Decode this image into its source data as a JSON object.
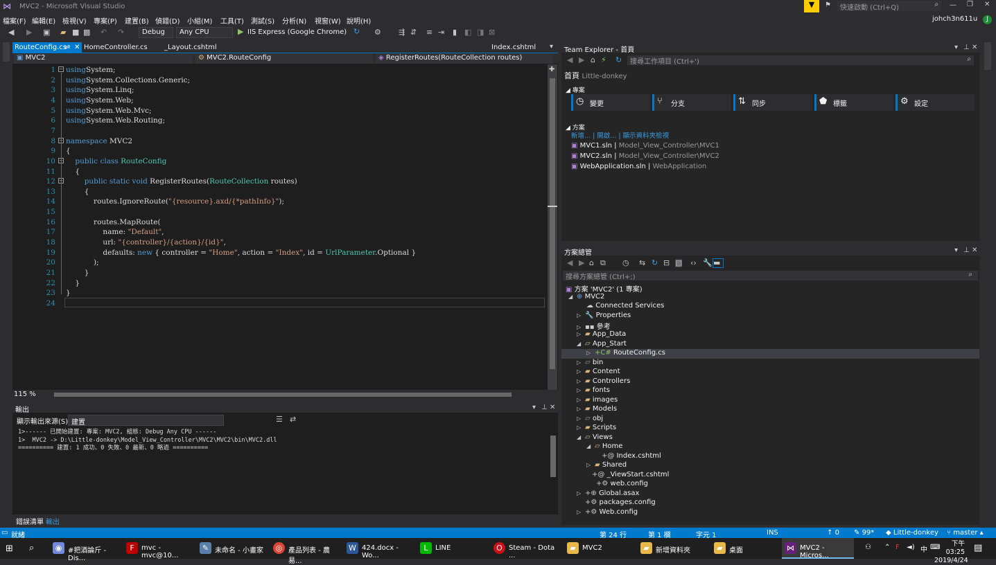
{
  "window": {
    "title": "MVC2 - Microsoft Visual Studio",
    "quick_launch": "快速啟動 (Ctrl+Q)",
    "user": "johch3n611u",
    "user_initial": "J"
  },
  "menu": [
    "檔案(F)",
    "編輯(E)",
    "檢視(V)",
    "專案(P)",
    "建置(B)",
    "偵錯(D)",
    "小組(M)",
    "工具(T)",
    "測試(S)",
    "分析(N)",
    "視窗(W)",
    "說明(H)"
  ],
  "toolbar": {
    "config": "Debug",
    "platform": "Any CPU",
    "run_label": "IIS Express (Google Chrome)"
  },
  "editor": {
    "tabs": [
      "RouteConfig.cs",
      "HomeController.cs",
      "_Layout.cshtml",
      "Index.cshtml"
    ],
    "nav": [
      "MVC2",
      "MVC2.RouteConfig",
      "RegisterRoutes(RouteCollection routes)"
    ],
    "zoom": "115 %",
    "lines": [
      [
        [
          "kw",
          "using"
        ],
        [
          "",
          "System;"
        ]
      ],
      [
        [
          "kw",
          "using"
        ],
        [
          "",
          "System.Collections.Generic;"
        ]
      ],
      [
        [
          "kw",
          "using"
        ],
        [
          "",
          "System.Linq;"
        ]
      ],
      [
        [
          "kw",
          "using"
        ],
        [
          "",
          "System.Web;"
        ]
      ],
      [
        [
          "kw",
          "using"
        ],
        [
          "",
          "System.Web.Mvc;"
        ]
      ],
      [
        [
          "kw",
          "using"
        ],
        [
          "",
          "System.Web.Routing;"
        ]
      ],
      [],
      [
        [
          "kw",
          "namespace"
        ],
        [
          "",
          " MVC2"
        ]
      ],
      [
        [
          "",
          "{"
        ]
      ],
      [
        [
          "",
          "    "
        ],
        [
          "kw",
          "public class"
        ],
        [
          "ty",
          " RouteConfig"
        ]
      ],
      [
        [
          "",
          "    {"
        ]
      ],
      [
        [
          "",
          "        "
        ],
        [
          "kw",
          "public static void"
        ],
        [
          "",
          " RegisterRoutes("
        ],
        [
          "ty",
          "RouteCollection"
        ],
        [
          "",
          " routes)"
        ]
      ],
      [
        [
          "",
          "        {"
        ]
      ],
      [
        [
          "",
          "            routes.IgnoreRoute("
        ],
        [
          "st",
          "\"{resource}.axd/{*pathInfo}\""
        ],
        [
          "",
          ");"
        ]
      ],
      [],
      [
        [
          "",
          "            routes.MapRoute("
        ]
      ],
      [
        [
          "",
          "                name: "
        ],
        [
          "st",
          "\"Default\""
        ],
        [
          "",
          ","
        ]
      ],
      [
        [
          "",
          "                url: "
        ],
        [
          "st",
          "\"{controller}/{action}/{id}\""
        ],
        [
          "",
          ","
        ]
      ],
      [
        [
          "",
          "                defaults: "
        ],
        [
          "kw",
          "new"
        ],
        [
          "",
          " { controller = "
        ],
        [
          "st",
          "\"Home\""
        ],
        [
          "",
          ", action = "
        ],
        [
          "st",
          "\"Index\""
        ],
        [
          "",
          ", id = "
        ],
        [
          "ty",
          "UrlParameter"
        ],
        [
          "",
          ".Optional }"
        ]
      ],
      [
        [
          "",
          "            );"
        ]
      ],
      [
        [
          "",
          "        }"
        ]
      ],
      [
        [
          "",
          "    }"
        ]
      ],
      [
        [
          "",
          "}"
        ]
      ],
      []
    ]
  },
  "output": {
    "title": "輸出",
    "source_label": "顯示輸出來源(S):",
    "source_value": "建置",
    "lines": [
      "1>------ 已開始建置: 專案: MVC2, 組態: Debug Any CPU ------",
      "1>  MVC2 -> D:\\Little-donkey\\Model_View_Controller\\MVC2\\MVC2\\bin\\MVC2.dll",
      "========== 建置: 1 成功、0 失敗、0 最新、0 略過 =========="
    ]
  },
  "bottom_tabs": [
    "錯誤清單",
    "輸出"
  ],
  "team_explorer": {
    "title": "Team Explorer - 首頁",
    "search": "搜尋工作項目 (Ctrl+')",
    "home": "首頁",
    "repo": "Little-donkey",
    "project_header": "專案",
    "tiles": [
      "變更",
      "分支",
      "同步",
      "標籤",
      "設定"
    ],
    "solution_header": "方案",
    "links": [
      "新增...",
      "開啟...",
      "顯示資料夾檢視"
    ],
    "solutions": [
      {
        "name": "MVC1.sln",
        "path": "Model_View_Controller\\MVC1"
      },
      {
        "name": "MVC2.sln",
        "path": "Model_View_Controller\\MVC2"
      },
      {
        "name": "WebApplication.sln",
        "path": "WebApplication"
      }
    ]
  },
  "solution_explorer": {
    "title": "方案總管",
    "search": "搜尋方案總管 (Ctrl+;)",
    "items": [
      "方案 'MVC2' (1 專案)",
      "MVC2",
      "Connected Services",
      "Properties",
      "參考",
      "App_Data",
      "App_Start",
      "RouteConfig.cs",
      "bin",
      "Content",
      "Controllers",
      "fonts",
      "images",
      "Models",
      "obj",
      "Scripts",
      "Views",
      "Home",
      "Index.cshtml",
      "Shared",
      "_ViewStart.cshtml",
      "web.config",
      "Global.asax",
      "packages.config",
      "Web.config"
    ]
  },
  "status": {
    "ready": "就緒",
    "line": "第 24 行",
    "col": "第 1 欄",
    "char": "字元 1",
    "ins": "INS",
    "up": "0",
    "pencil": "99*",
    "repo": "Little-donkey",
    "branch": "master"
  },
  "taskbar": {
    "apps": [
      "#把酒論斤 - Dis...",
      "mvc - mvc@10...",
      "未命名 - 小畫家",
      "產品列表 - 農易...",
      "424.docx - Wo...",
      "LINE",
      "Steam - Dota ...",
      "MVC2",
      "新增資料夾",
      "桌面",
      "MVC2 - Micros..."
    ],
    "time": "下午 03:25",
    "date": "2019/4/24",
    "lang": "中"
  }
}
